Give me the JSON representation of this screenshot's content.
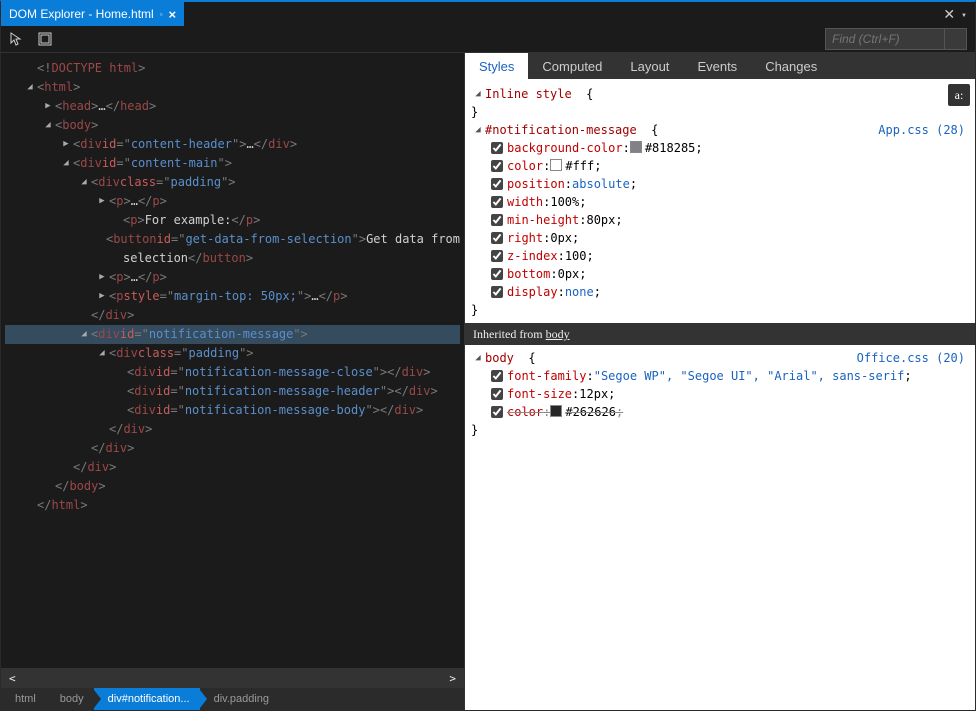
{
  "title": "DOM Explorer - Home.html",
  "search_placeholder": "Find (Ctrl+F)",
  "breadcrumbs": [
    "html",
    "body",
    "div#notification...",
    "div.padding"
  ],
  "active_crumb_index": 2,
  "tree": [
    {
      "indent": 0,
      "twist": "none",
      "parts": [
        {
          "t": "punct",
          "v": "<!"
        },
        {
          "t": "tag",
          "v": "DOCTYPE html"
        },
        {
          "t": "punct",
          "v": ">"
        }
      ]
    },
    {
      "indent": 0,
      "twist": "open",
      "parts": [
        {
          "t": "punct",
          "v": "<"
        },
        {
          "t": "tag",
          "v": "html"
        },
        {
          "t": "punct",
          "v": ">"
        }
      ]
    },
    {
      "indent": 1,
      "twist": "closed",
      "parts": [
        {
          "t": "punct",
          "v": "<"
        },
        {
          "t": "tag",
          "v": "head"
        },
        {
          "t": "punct",
          "v": ">"
        },
        {
          "t": "text",
          "v": "…"
        },
        {
          "t": "punct",
          "v": "</"
        },
        {
          "t": "tag",
          "v": "head"
        },
        {
          "t": "punct",
          "v": ">"
        }
      ]
    },
    {
      "indent": 1,
      "twist": "open",
      "parts": [
        {
          "t": "punct",
          "v": "<"
        },
        {
          "t": "tag",
          "v": "body"
        },
        {
          "t": "punct",
          "v": ">"
        }
      ]
    },
    {
      "indent": 2,
      "twist": "closed",
      "parts": [
        {
          "t": "punct",
          "v": "<"
        },
        {
          "t": "tag",
          "v": "div"
        },
        {
          "t": "text",
          "v": " "
        },
        {
          "t": "attr",
          "v": "id"
        },
        {
          "t": "punct",
          "v": "=\""
        },
        {
          "t": "val",
          "v": "content-header"
        },
        {
          "t": "punct",
          "v": "\">"
        },
        {
          "t": "text",
          "v": "…"
        },
        {
          "t": "punct",
          "v": "</"
        },
        {
          "t": "tag",
          "v": "div"
        },
        {
          "t": "punct",
          "v": ">"
        }
      ]
    },
    {
      "indent": 2,
      "twist": "open",
      "parts": [
        {
          "t": "punct",
          "v": "<"
        },
        {
          "t": "tag",
          "v": "div"
        },
        {
          "t": "text",
          "v": " "
        },
        {
          "t": "attr",
          "v": "id"
        },
        {
          "t": "punct",
          "v": "=\""
        },
        {
          "t": "val",
          "v": "content-main"
        },
        {
          "t": "punct",
          "v": "\">"
        }
      ]
    },
    {
      "indent": 3,
      "twist": "open",
      "parts": [
        {
          "t": "punct",
          "v": "<"
        },
        {
          "t": "tag",
          "v": "div"
        },
        {
          "t": "text",
          "v": " "
        },
        {
          "t": "attr",
          "v": "class"
        },
        {
          "t": "punct",
          "v": "=\""
        },
        {
          "t": "val",
          "v": "padding"
        },
        {
          "t": "punct",
          "v": "\">"
        }
      ]
    },
    {
      "indent": 4,
      "twist": "closed",
      "parts": [
        {
          "t": "punct",
          "v": "<"
        },
        {
          "t": "tag",
          "v": "p"
        },
        {
          "t": "punct",
          "v": ">"
        },
        {
          "t": "text",
          "v": "…"
        },
        {
          "t": "punct",
          "v": "</"
        },
        {
          "t": "tag",
          "v": "p"
        },
        {
          "t": "punct",
          "v": ">"
        }
      ]
    },
    {
      "indent": 4,
      "twist": "none",
      "extra_sp": true,
      "parts": [
        {
          "t": "punct",
          "v": "<"
        },
        {
          "t": "tag",
          "v": "p"
        },
        {
          "t": "punct",
          "v": ">"
        },
        {
          "t": "text",
          "v": "For example:"
        },
        {
          "t": "punct",
          "v": "</"
        },
        {
          "t": "tag",
          "v": "p"
        },
        {
          "t": "punct",
          "v": ">"
        }
      ]
    },
    {
      "indent": 4,
      "twist": "none",
      "extra_sp": true,
      "parts": [
        {
          "t": "punct",
          "v": "<"
        },
        {
          "t": "tag",
          "v": "button"
        },
        {
          "t": "text",
          "v": " "
        },
        {
          "t": "attr",
          "v": "id"
        },
        {
          "t": "punct",
          "v": "=\""
        },
        {
          "t": "val",
          "v": "get-data-from-selection"
        },
        {
          "t": "punct",
          "v": "\">"
        },
        {
          "t": "text",
          "v": "Get data from"
        }
      ]
    },
    {
      "indent": 4,
      "twist": "none",
      "extra_sp": true,
      "parts": [
        {
          "t": "text",
          "v": "selection"
        },
        {
          "t": "punct",
          "v": "</"
        },
        {
          "t": "tag",
          "v": "button"
        },
        {
          "t": "punct",
          "v": ">"
        }
      ]
    },
    {
      "indent": 4,
      "twist": "closed",
      "parts": [
        {
          "t": "punct",
          "v": "<"
        },
        {
          "t": "tag",
          "v": "p"
        },
        {
          "t": "punct",
          "v": ">"
        },
        {
          "t": "text",
          "v": "…"
        },
        {
          "t": "punct",
          "v": "</"
        },
        {
          "t": "tag",
          "v": "p"
        },
        {
          "t": "punct",
          "v": ">"
        }
      ]
    },
    {
      "indent": 4,
      "twist": "closed",
      "parts": [
        {
          "t": "punct",
          "v": "<"
        },
        {
          "t": "tag",
          "v": "p"
        },
        {
          "t": "text",
          "v": " "
        },
        {
          "t": "attr",
          "v": "style"
        },
        {
          "t": "punct",
          "v": "=\""
        },
        {
          "t": "val",
          "v": "margin-top: 50px;"
        },
        {
          "t": "punct",
          "v": "\">"
        },
        {
          "t": "text",
          "v": "…"
        },
        {
          "t": "punct",
          "v": "</"
        },
        {
          "t": "tag",
          "v": "p"
        },
        {
          "t": "punct",
          "v": ">"
        }
      ]
    },
    {
      "indent": 3,
      "twist": "none",
      "parts": [
        {
          "t": "punct",
          "v": "</"
        },
        {
          "t": "tag",
          "v": "div"
        },
        {
          "t": "punct",
          "v": ">"
        }
      ]
    },
    {
      "indent": 3,
      "twist": "open",
      "highlight": true,
      "parts": [
        {
          "t": "punct",
          "v": "<"
        },
        {
          "t": "tag",
          "v": "div"
        },
        {
          "t": "text",
          "v": " "
        },
        {
          "t": "attr",
          "v": "id"
        },
        {
          "t": "punct",
          "v": "=\""
        },
        {
          "t": "val",
          "v": "notification-message"
        },
        {
          "t": "punct",
          "v": "\">"
        }
      ]
    },
    {
      "indent": 4,
      "twist": "open",
      "parts": [
        {
          "t": "punct",
          "v": "<"
        },
        {
          "t": "tag",
          "v": "div"
        },
        {
          "t": "text",
          "v": " "
        },
        {
          "t": "attr",
          "v": "class"
        },
        {
          "t": "punct",
          "v": "=\""
        },
        {
          "t": "val",
          "v": "padding"
        },
        {
          "t": "punct",
          "v": "\">"
        }
      ]
    },
    {
      "indent": 5,
      "twist": "none",
      "parts": [
        {
          "t": "punct",
          "v": "<"
        },
        {
          "t": "tag",
          "v": "div"
        },
        {
          "t": "text",
          "v": " "
        },
        {
          "t": "attr",
          "v": "id"
        },
        {
          "t": "punct",
          "v": "=\""
        },
        {
          "t": "val",
          "v": "notification-message-close"
        },
        {
          "t": "punct",
          "v": "\"></"
        },
        {
          "t": "tag",
          "v": "div"
        },
        {
          "t": "punct",
          "v": ">"
        }
      ]
    },
    {
      "indent": 5,
      "twist": "none",
      "parts": [
        {
          "t": "punct",
          "v": "<"
        },
        {
          "t": "tag",
          "v": "div"
        },
        {
          "t": "text",
          "v": " "
        },
        {
          "t": "attr",
          "v": "id"
        },
        {
          "t": "punct",
          "v": "=\""
        },
        {
          "t": "val",
          "v": "notification-message-header"
        },
        {
          "t": "punct",
          "v": "\"></"
        },
        {
          "t": "tag",
          "v": "div"
        },
        {
          "t": "punct",
          "v": ">"
        }
      ]
    },
    {
      "indent": 5,
      "twist": "none",
      "parts": [
        {
          "t": "punct",
          "v": "<"
        },
        {
          "t": "tag",
          "v": "div"
        },
        {
          "t": "text",
          "v": " "
        },
        {
          "t": "attr",
          "v": "id"
        },
        {
          "t": "punct",
          "v": "=\""
        },
        {
          "t": "val",
          "v": "notification-message-body"
        },
        {
          "t": "punct",
          "v": "\"></"
        },
        {
          "t": "tag",
          "v": "div"
        },
        {
          "t": "punct",
          "v": ">"
        }
      ]
    },
    {
      "indent": 4,
      "twist": "none",
      "parts": [
        {
          "t": "punct",
          "v": "</"
        },
        {
          "t": "tag",
          "v": "div"
        },
        {
          "t": "punct",
          "v": ">"
        }
      ]
    },
    {
      "indent": 3,
      "twist": "none",
      "parts": [
        {
          "t": "punct",
          "v": "</"
        },
        {
          "t": "tag",
          "v": "div"
        },
        {
          "t": "punct",
          "v": ">"
        }
      ]
    },
    {
      "indent": 2,
      "twist": "none",
      "parts": [
        {
          "t": "punct",
          "v": "</"
        },
        {
          "t": "tag",
          "v": "div"
        },
        {
          "t": "punct",
          "v": ">"
        }
      ]
    },
    {
      "indent": 1,
      "twist": "none",
      "parts": [
        {
          "t": "punct",
          "v": "</"
        },
        {
          "t": "tag",
          "v": "body"
        },
        {
          "t": "punct",
          "v": ">"
        }
      ]
    },
    {
      "indent": 0,
      "twist": "none",
      "parts": [
        {
          "t": "punct",
          "v": "</"
        },
        {
          "t": "tag",
          "v": "html"
        },
        {
          "t": "punct",
          "v": ">"
        }
      ]
    }
  ],
  "right_tabs": [
    "Styles",
    "Computed",
    "Layout",
    "Events",
    "Changes"
  ],
  "right_tab_active": 0,
  "style_sections": [
    {
      "selector": "Inline style",
      "source": null,
      "rules": []
    },
    {
      "selector": "#notification-message",
      "source": "App.css (28)",
      "rules": [
        {
          "prop": "background-color",
          "val": "#818285",
          "swatch": "#818285"
        },
        {
          "prop": "color",
          "val": "#fff",
          "swatch": "#ffffff"
        },
        {
          "prop": "position",
          "val": "absolute"
        },
        {
          "prop": "width",
          "val": "100%"
        },
        {
          "prop": "min-height",
          "val": "80px"
        },
        {
          "prop": "right",
          "val": "0px"
        },
        {
          "prop": "z-index",
          "val": "100"
        },
        {
          "prop": "bottom",
          "val": "0px"
        },
        {
          "prop": "display",
          "val": "none"
        }
      ]
    },
    {
      "inherited_label": "Inherited from body",
      "selector": "body",
      "source": "Office.css (20)",
      "rules": [
        {
          "prop": "font-family",
          "val": "\"Segoe WP\", \"Segoe UI\", \"Arial\", sans-serif",
          "string": true
        },
        {
          "prop": "font-size",
          "val": "12px"
        },
        {
          "prop": "color",
          "val": "#262626",
          "swatch": "#262626",
          "strike": true
        }
      ]
    }
  ],
  "a_icon": "a:"
}
